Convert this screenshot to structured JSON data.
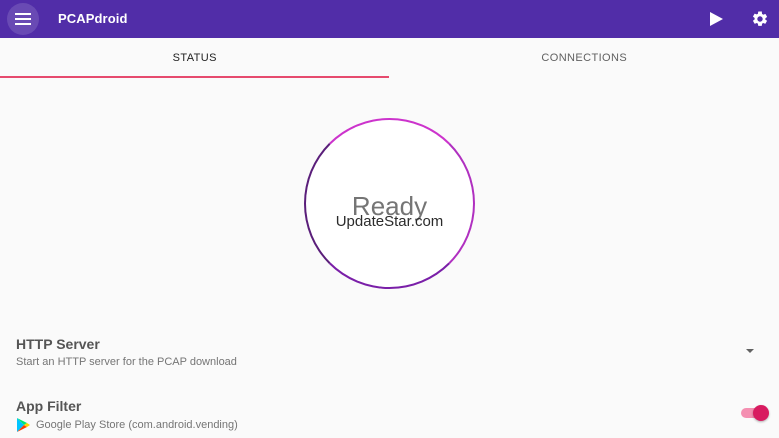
{
  "app": {
    "title": "PCAPdroid"
  },
  "toolbar": {
    "menu_icon": "hamburger-icon",
    "play_icon": "play-icon",
    "settings_icon": "gear-icon"
  },
  "tabs": [
    {
      "label": "STATUS",
      "active": true
    },
    {
      "label": "CONNECTIONS",
      "active": false
    }
  ],
  "status": {
    "text": "Ready",
    "watermark": "UpdateStar.com"
  },
  "preferences": {
    "http_server": {
      "title": "HTTP Server",
      "summary": "Start an HTTP server for the PCAP download"
    },
    "app_filter": {
      "title": "App Filter",
      "summary": "Google Play Store (com.android.vending)",
      "enabled": true
    }
  },
  "colors": {
    "primary": "#512da8",
    "tab_indicator": "#e64a6e",
    "toggle_thumb": "#d81b60",
    "toggle_track": "#f48fb1"
  }
}
